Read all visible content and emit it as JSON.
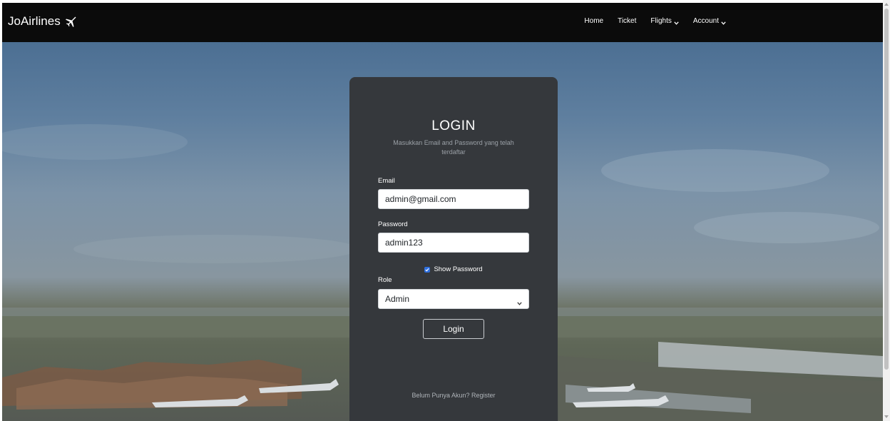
{
  "navbar": {
    "brand": "JoAirlines",
    "brand_icon": "plane-icon",
    "items": [
      {
        "label": "Home",
        "dropdown": false
      },
      {
        "label": "Ticket",
        "dropdown": false
      },
      {
        "label": "Flights",
        "dropdown": true
      },
      {
        "label": "Account",
        "dropdown": true
      }
    ]
  },
  "login": {
    "title": "LOGIN",
    "subtitle": "Masukkan Email and Password yang telah terdaftar",
    "email_label": "Email",
    "email_value": "admin@gmail.com",
    "password_label": "Password",
    "password_value": "admin123",
    "show_password_label": "Show Password",
    "show_password_checked": true,
    "role_label": "Role",
    "role_value": "Admin",
    "button_label": "Login",
    "register_prompt": "Belum Punya Akun?",
    "register_link": "Register"
  },
  "colors": {
    "navbar_bg": "#0b0b0b",
    "card_bg": "#35383c",
    "checkbox_accent": "#2f6fde"
  }
}
